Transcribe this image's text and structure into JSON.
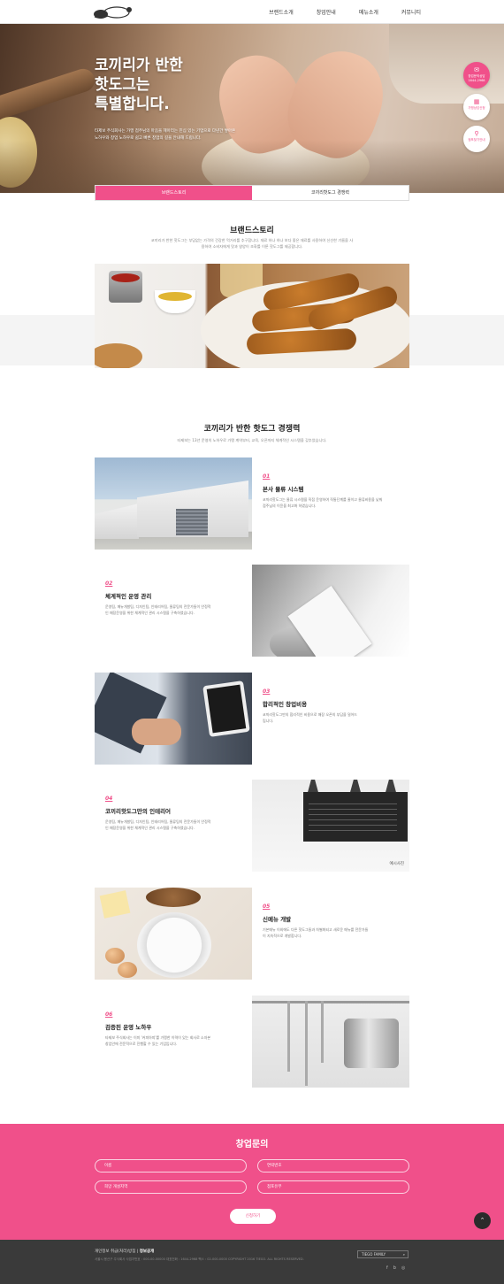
{
  "header": {
    "logo_alt": "코끼리 핫도그",
    "nav": [
      "브랜드소개",
      "창업안내",
      "메뉴소개",
      "커뮤니티"
    ]
  },
  "hero": {
    "title_lines": [
      "코끼리가 반한",
      "핫도그는",
      "특별합니다."
    ],
    "description": "타제보 주식회사는 가맹 점주님의 마음을 헤아리는 진심 있는 기업으로 다년간 쌓아온 노하우와 창업 노하우로 쉽고 빠른 창업의 길을 안내해 드립니다."
  },
  "quick_menu": [
    {
      "label": "창업문의상담 1644-2968",
      "icon": "chat-icon"
    },
    {
      "label": "가맹상담신청",
      "icon": "calendar-icon"
    },
    {
      "label": "점포찾기안내",
      "icon": "location-pin-icon"
    }
  ],
  "tabs": [
    "브랜드스토리",
    "코끼리핫도그 경쟁력"
  ],
  "brand_story": {
    "title": "브랜드스토리",
    "description": "코끼리가 반한 핫도그는 부담없는 가격의 건강한 먹거리를 추구합니다. 재료 하나 하나 보다 좋은 재료를 사용하여 신선한 기름을 사용하여 소비자에게 맛과 영양이 조화를 이룬 핫도그를 제공합니다."
  },
  "competitiveness": {
    "title": "코끼리가 반한 핫도그 경쟁력",
    "description": "타제보는 13년 운영의 노하우로 가맹 계약부터, 교육, 오픈까지 체계적인 시스템을 갖추었습니다.",
    "items": [
      {
        "num": "01",
        "title": "본사 물류 시스템",
        "desc": "코끼리핫도그는 물류 시스템을 직접 운영하여 직통단계를 줄이고 물류비용을 낮춰 점주님의 이윤을 최고화 하였습니다."
      },
      {
        "num": "02",
        "title": "체계적인 운영 관리",
        "desc": "운영팀, 메뉴개발팀, 디자인팀, 인테리어팀, 물류팀의 전문가들이 안정적인 매장운영을 위한 체계적인 관리 시스템을 구축하였습니다."
      },
      {
        "num": "03",
        "title": "합리적인 창업비용",
        "desc": "코끼리핫도그만의 합리적인 비용으로 매장 오픈의 부담을 덜어드립니다."
      },
      {
        "num": "04",
        "title": "코끼리핫도그만의 인테리어",
        "desc": "운영팀, 메뉴개발팀, 디자인팀, 인테리어팀, 물류팀의 전문가들이 안정적인 매장운영을 위한 체계적인 관리 시스템을 구축하였습니다.",
        "caption": "예시사진"
      },
      {
        "num": "05",
        "title": "신메뉴 개발",
        "desc": "기본메뉴 이외에도 다른 핫도그들과 차별화되고 새로운 메뉴를 전문가들이 지속적으로 개발합니다."
      },
      {
        "num": "06",
        "title": "검증된 운영 노하우",
        "desc": "타제보 주식회사는 이미 '커피아띠'를 가맹한 이력이 있는 회사로 소자본 창업안에 전문적으로 진행할 수 있는 기업입니다."
      }
    ]
  },
  "inquiry": {
    "title": "창업문의",
    "fields": [
      "이름",
      "연락번호",
      "희망 개설지역",
      "점포유무"
    ],
    "submit": "신청하기"
  },
  "footer": {
    "links": [
      "개인정보 취급(처리)방침",
      "정보공개"
    ],
    "info": "서울시 용산구 주식회사 사업자번호 : 000-00-00000 대표전화 : 1644-2968 팩스 : 02-000-0000 COPYRIGHT 2016 TIEGO. ALL RIGHTS RESERVED.",
    "family": "TIEGO FAMILY",
    "sns": [
      "f",
      "b",
      "◎"
    ]
  },
  "colors": {
    "accent": "#f0508a",
    "footer": "#3a3a3a"
  }
}
